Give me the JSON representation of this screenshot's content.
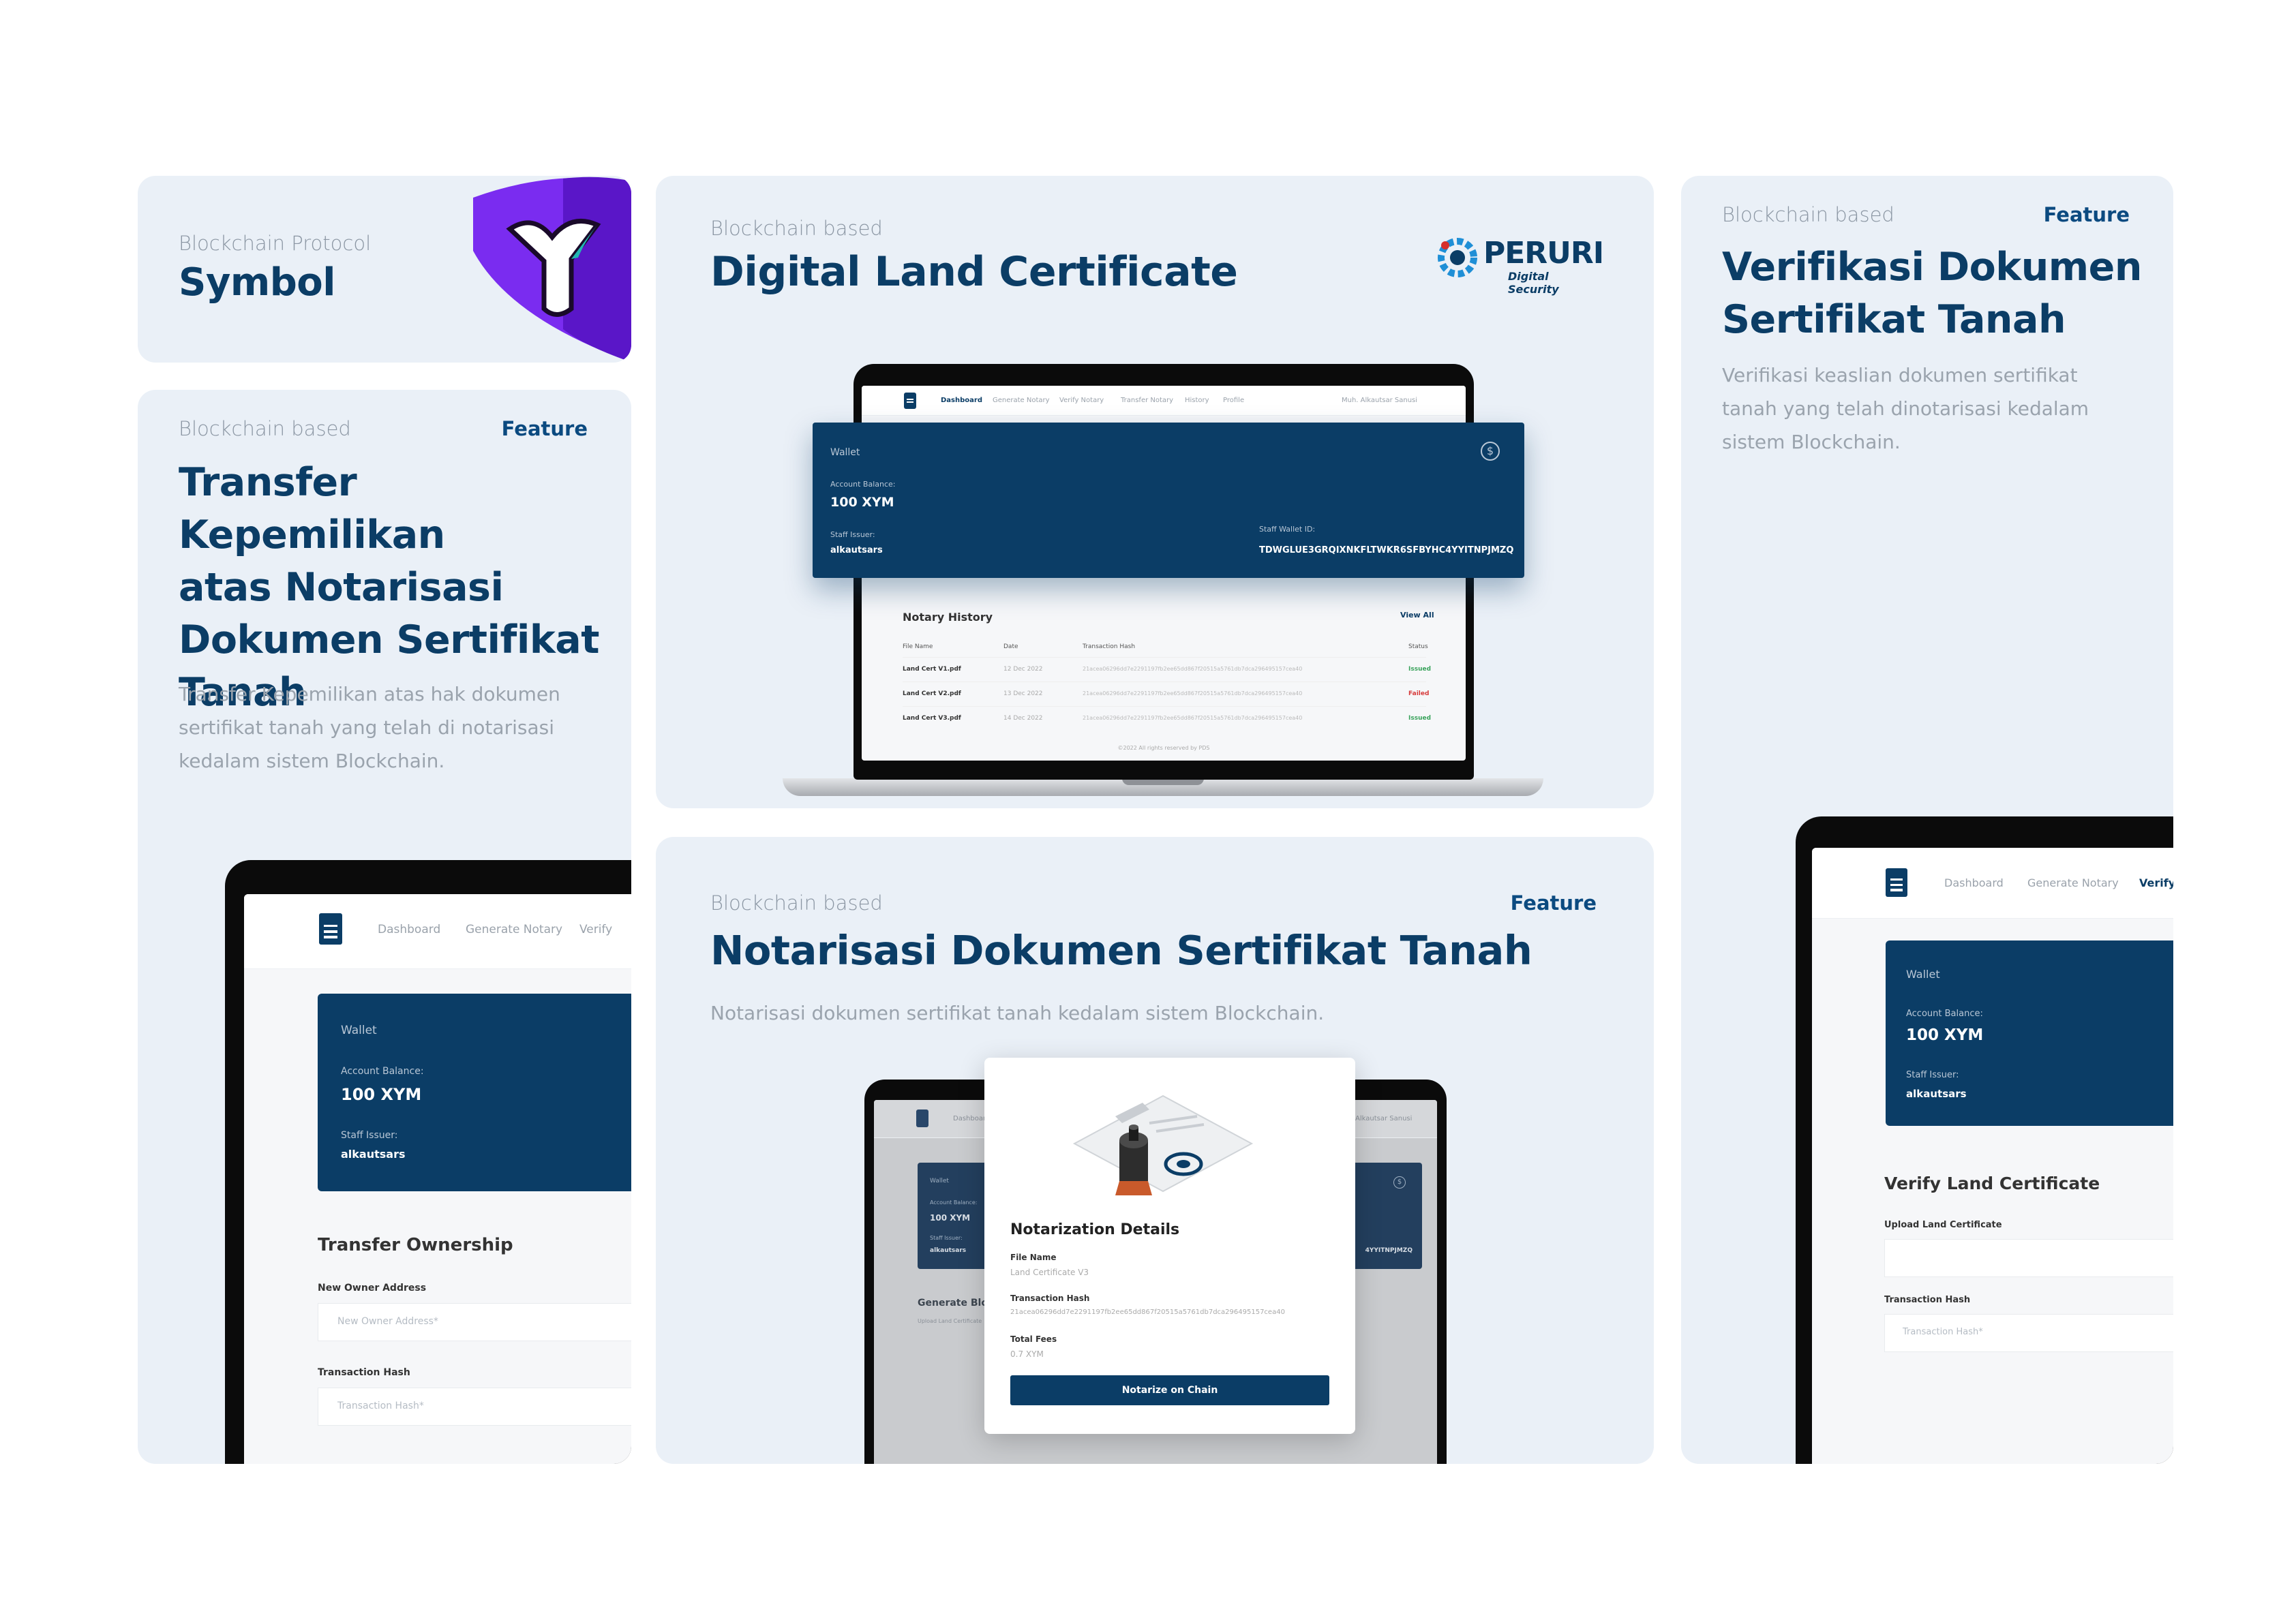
{
  "symbol_card": {
    "eyebrow": "Blockchain Protocol",
    "title": "Symbol"
  },
  "transfer_card": {
    "eyebrow": "Blockchain based",
    "feature": "Feature",
    "title_l1": "Transfer Kepemilikan",
    "title_l2": "atas Notarisasi",
    "title_l3": "Dokumen Sertifikat",
    "title_l4": "Tanah",
    "desc_l1": "Transfer Kepemilikan atas hak dokumen",
    "desc_l2": "sertifikat tanah yang telah di notarisasi",
    "desc_l3": "kedalam sistem Blockchain.",
    "app": {
      "nav": [
        "Dashboard",
        "Generate Notary",
        "Verify"
      ],
      "wallet_label": "Wallet",
      "balance_label": "Account Balance:",
      "balance": "100 XYM",
      "staff_label": "Staff Issuer:",
      "staff": "alkautsars",
      "section": "Transfer Ownership",
      "f1_label": "New Owner Address",
      "f1_ph": "New Owner Address*",
      "f2_label": "Transaction Hash",
      "f2_ph": "Transaction Hash*"
    }
  },
  "land_card": {
    "eyebrow": "Blockchain based",
    "title": "Digital Land Certificate",
    "brand": "PERURI",
    "brand_sub": "Digital Security",
    "app": {
      "nav": [
        "Dashboard",
        "Generate Notary",
        "Verify Notary",
        "Transfer Notary",
        "History",
        "Profile"
      ],
      "user": "Muh. Alkautsar Sanusi",
      "wallet_label": "Wallet",
      "balance_label": "Account Balance:",
      "balance": "100 XYM",
      "staff_label": "Staff Issuer:",
      "staff": "alkautsars",
      "wallet_id_label": "Staff Wallet ID:",
      "wallet_id": "TDWGLUE3GRQIXNKFLTWKR6SFBYHC4YYITNPJMZQ",
      "history_title": "Notary History",
      "view_all": "View All",
      "cols": [
        "File Name",
        "Date",
        "Transaction Hash",
        "Status"
      ],
      "rows": [
        {
          "file": "Land Cert V1.pdf",
          "date": "12 Dec 2022",
          "hash": "21acea06296dd7e2291197fb2ee65dd867f20515a5761db7dca296495157cea40",
          "status": "Issued"
        },
        {
          "file": "Land Cert V2.pdf",
          "date": "13 Dec 2022",
          "hash": "21acea06296dd7e2291197fb2ee65dd867f20515a5761db7dca296495157cea40",
          "status": "Failed"
        },
        {
          "file": "Land Cert V3.pdf",
          "date": "14 Dec 2022",
          "hash": "21acea06296dd7e2291197fb2ee65dd867f20515a5761db7dca296495157cea40",
          "status": "Issued"
        }
      ],
      "footer": "©2022 All rights reserved by PDS"
    }
  },
  "notary_card": {
    "eyebrow": "Blockchain based",
    "feature": "Feature",
    "title": "Notarisasi Dokumen Sertifikat Tanah",
    "desc": "Notarisasi dokumen sertifikat tanah kedalam sistem Blockchain.",
    "modal": {
      "title": "Notarization Details",
      "file_label": "File Name",
      "file": "Land Certificate V3",
      "hash_label": "Transaction Hash",
      "hash": "21acea06296dd7e2291197fb2ee65dd867f20515a5761db7dca296495157cea40",
      "fees_label": "Total Fees",
      "fees": "0.7 XYM",
      "button": "Notarize on Chain"
    },
    "bg": {
      "nav": "Dashboard",
      "user": "Alkautsar Sanusi",
      "wallet_label": "Wallet",
      "balance_label": "Account Balance:",
      "balance": "100 XYM",
      "staff_label": "Staff Issuer:",
      "staff": "alkautsars",
      "wallet_id": "4YYITNPJMZQ",
      "section": "Generate Blo",
      "upload": "Upload Land Certificate"
    }
  },
  "verify_card": {
    "eyebrow": "Blockchain based",
    "feature": "Feature",
    "title_l1": "Verifikasi Dokumen",
    "title_l2": "Sertifikat Tanah",
    "desc_l1": "Verifikasi keaslian dokumen sertifikat",
    "desc_l2": "tanah yang telah dinotarisasi kedalam",
    "desc_l3": "sistem Blockchain.",
    "app": {
      "nav": [
        "Dashboard",
        "Generate Notary",
        "Verify"
      ],
      "wallet_label": "Wallet",
      "balance_label": "Account Balance:",
      "balance": "100 XYM",
      "staff_label": "Staff Issuer:",
      "staff": "alkautsars",
      "section": "Verify Land Certificate",
      "f1_label": "Upload Land Certificate",
      "f2_label": "Transaction Hash",
      "f2_ph": "Transaction Hash*"
    }
  },
  "colors": {
    "navy": "#0b3d66",
    "card": "#eaf0f7",
    "issued": "#3aa35c",
    "failed": "#d63b3b",
    "symbol_purple": "#7a2cf0"
  }
}
